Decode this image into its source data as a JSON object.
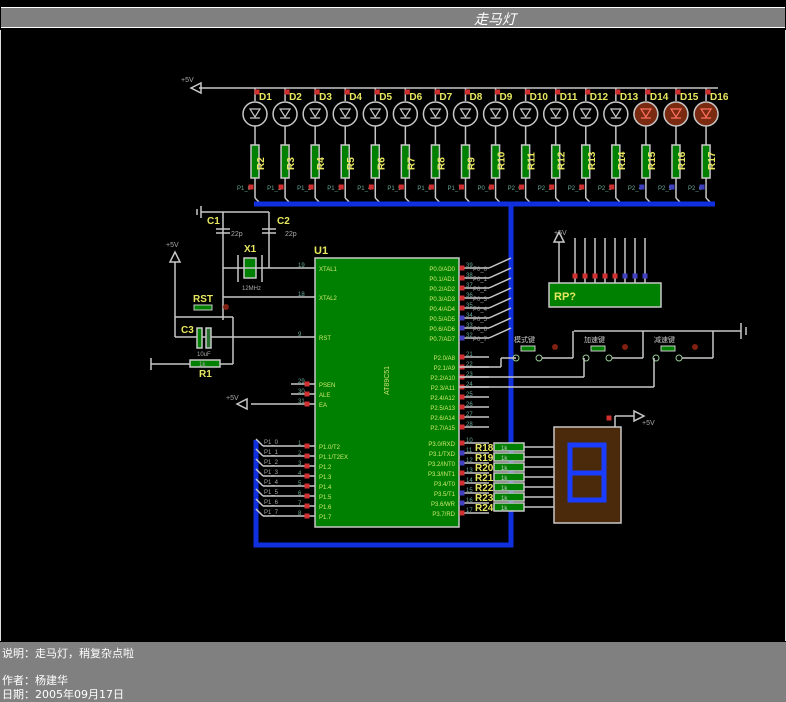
{
  "window": {
    "title": "走马灯"
  },
  "info": {
    "description": "说明：走马灯，稍复杂点啦",
    "author": "作者：杨建华",
    "date": "日期：2005年09月17日"
  },
  "schematic": {
    "power_label": "+5V",
    "leds": [
      "D1",
      "D2",
      "D3",
      "D4",
      "D5",
      "D6",
      "D7",
      "D8",
      "D9",
      "D10",
      "D11",
      "D12",
      "D13",
      "D14",
      "D15",
      "D16"
    ],
    "leds_lit": [
      false,
      false,
      false,
      false,
      false,
      false,
      false,
      false,
      false,
      false,
      false,
      false,
      false,
      true,
      true,
      true
    ],
    "led_resistors": [
      "R2",
      "R3",
      "R4",
      "R5",
      "R6",
      "R7",
      "R8",
      "R9",
      "R10",
      "R11",
      "R12",
      "R13",
      "R14",
      "R15",
      "R16",
      "R17"
    ],
    "led_nets": [
      "P1_0",
      "P1_1",
      "P1_2",
      "P1_3",
      "P1_4",
      "P1_5",
      "P1_6",
      "P1_7",
      "P0_0",
      "P2_0",
      "P2_1",
      "P2_2",
      "P2_3",
      "P2_4",
      "P2_5",
      "P2_6"
    ],
    "crystal": {
      "c1": "C1",
      "c2": "C2",
      "cap_value": "22p",
      "x1": "X1",
      "x1_value": "12MHz"
    },
    "reset": {
      "button": "RST",
      "cap": "C3",
      "cap_value": "10uF",
      "res": "R1",
      "res_value": "1k"
    },
    "mcu": {
      "ref": "U1",
      "part": "AT89C51",
      "left_pins": [
        {
          "num": "19",
          "name": "XTAL1"
        },
        {
          "num": "18",
          "name": "XTAL2"
        },
        {
          "num": "9",
          "name": "RST"
        },
        {
          "num": "29",
          "name": "PSEN"
        },
        {
          "num": "30",
          "name": "ALE"
        },
        {
          "num": "31",
          "name": "EA"
        },
        {
          "num": "1",
          "name": "P1.0/T2"
        },
        {
          "num": "2",
          "name": "P1.1/T2EX"
        },
        {
          "num": "3",
          "name": "P1.2"
        },
        {
          "num": "4",
          "name": "P1.3"
        },
        {
          "num": "5",
          "name": "P1.4"
        },
        {
          "num": "6",
          "name": "P1.5"
        },
        {
          "num": "7",
          "name": "P1.6"
        },
        {
          "num": "8",
          "name": "P1.7"
        }
      ],
      "right_pins": [
        {
          "num": "39",
          "name": "P0.0/AD0"
        },
        {
          "num": "38",
          "name": "P0.1/AD1"
        },
        {
          "num": "37",
          "name": "P0.2/AD2"
        },
        {
          "num": "36",
          "name": "P0.3/AD3"
        },
        {
          "num": "35",
          "name": "P0.4/AD4"
        },
        {
          "num": "34",
          "name": "P0.5/AD5"
        },
        {
          "num": "33",
          "name": "P0.6/AD6"
        },
        {
          "num": "32",
          "name": "P0.7/AD7"
        },
        {
          "num": "21",
          "name": "P2.0/A8"
        },
        {
          "num": "22",
          "name": "P2.1/A9"
        },
        {
          "num": "23",
          "name": "P2.2/A10"
        },
        {
          "num": "24",
          "name": "P2.3/A11"
        },
        {
          "num": "25",
          "name": "P2.4/A12"
        },
        {
          "num": "26",
          "name": "P2.5/A13"
        },
        {
          "num": "27",
          "name": "P2.6/A14"
        },
        {
          "num": "28",
          "name": "P2.7/A15"
        },
        {
          "num": "10",
          "name": "P3.0/RXD"
        },
        {
          "num": "11",
          "name": "P3.1/TXD"
        },
        {
          "num": "12",
          "name": "P3.2/INT0"
        },
        {
          "num": "13",
          "name": "P3.3/INT1"
        },
        {
          "num": "14",
          "name": "P3.4/T0"
        },
        {
          "num": "15",
          "name": "P3.5/T1"
        },
        {
          "num": "16",
          "name": "P3.6/WR"
        },
        {
          "num": "17",
          "name": "P3.7/RD"
        }
      ],
      "p0_nets": [
        "P0_0",
        "P0_1",
        "P0_2",
        "P0_3",
        "P0_4",
        "P0_5",
        "P0_6",
        "P0_7"
      ],
      "p1_nets": [
        "P1_0",
        "P1_1",
        "P1_2",
        "P1_3",
        "P1_4",
        "P1_5",
        "P1_6",
        "P1_7"
      ]
    },
    "resistor_pack": {
      "ref": "RP?"
    },
    "buttons": [
      "模式键",
      "加速键",
      "减速键"
    ],
    "seg_resistors": [
      "R18",
      "R19",
      "R20",
      "R21",
      "R22",
      "R23",
      "R24"
    ],
    "seg_res_value": "1k"
  },
  "colors": {
    "grid_bg": "#000000",
    "wire": "#c8c8c8",
    "bus": "#1030e0",
    "component": "#008000",
    "label": "#e8e860",
    "led_lit": "#7a2a10",
    "seg_body": "#4a2a0a",
    "seg_lit": "#1a3cff"
  }
}
